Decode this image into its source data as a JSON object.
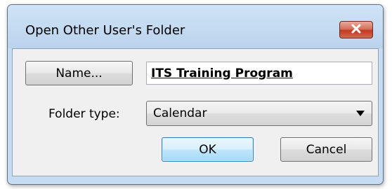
{
  "dialog": {
    "title": "Open Other User's Folder",
    "close_icon": "close-icon"
  },
  "form": {
    "name_button_label": "Name...",
    "name_value": "ITS Training Program",
    "folder_type_label": "Folder type:",
    "folder_type_value": "Calendar"
  },
  "actions": {
    "ok_label": "OK",
    "cancel_label": "Cancel"
  },
  "colors": {
    "close_button": "#c74a32",
    "titlebar": "#c6dcf2",
    "default_button_border": "#3c7fb1"
  }
}
